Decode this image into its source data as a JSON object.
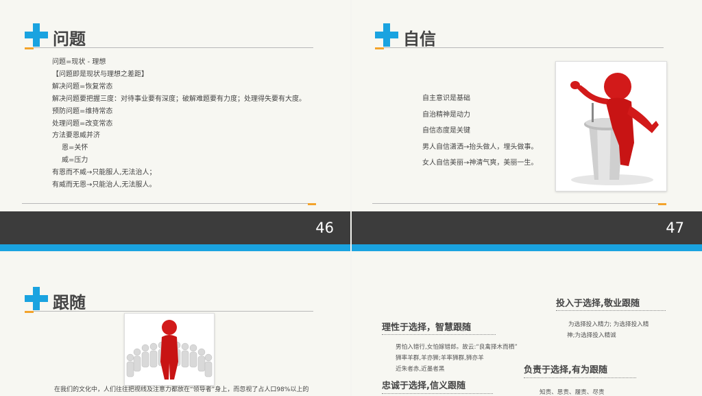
{
  "slide46": {
    "title": "问题",
    "lines": [
      "问题=现状 - 理想",
      "【问题即是现状与理想之差距】",
      "解决问题=恢复常态",
      "解决问题要把握三度：对待事业要有深度；破解难题要有力度；处理得失要有大度。",
      "预防问题=维持常态",
      "处理问题=改变常态",
      "方法要恩威并济",
      "恩=关怀",
      "威=压力",
      "有恩而不威→只能服人,无法治人；",
      "有威而无恩→只能治人,无法服人。"
    ],
    "page_number": "46"
  },
  "slide47": {
    "title": "自信",
    "lines": [
      "自主意识是基础",
      "自治精神是动力",
      "自信态度是关键",
      "男人自信潇洒→抬头做人，埋头做事。",
      "女人自信美丽→神清气爽，美丽一生。"
    ],
    "page_number": "47"
  },
  "slide48": {
    "title": "跟随",
    "caption": "在我们的文化中，人们往往把视线及注意力都放在“领导者”身上，而忽视了占人口98%以上的"
  },
  "slide49": {
    "section1": {
      "heading": "投入于选择,敬业跟随",
      "lines": [
        "为选择投入精力; 为选择投入精",
        "神;为选择投入精诚"
      ]
    },
    "section2": {
      "heading": "理性于选择，智慧跟随",
      "lines": [
        "男怕入错行,女怕嫁错郎。故云:“良禽择木而栖”",
        "狮率羊群,羊亦狮;羊率狮群,狮亦羊",
        "近朱者赤,近墨者黑"
      ]
    },
    "section3": {
      "heading": "负责于选择,有为跟随",
      "lines": [
        "知责、思责、履责、尽责"
      ]
    },
    "section4": {
      "heading": "忠诚于选择,信义跟随"
    }
  },
  "colors": {
    "accent_blue": "#1aa3e0",
    "accent_orange": "#f3a32b",
    "footer_dark": "#3c3c3c"
  },
  "icons": [
    "plus-icon",
    "speaker-figure-image",
    "leader-crowd-image"
  ]
}
